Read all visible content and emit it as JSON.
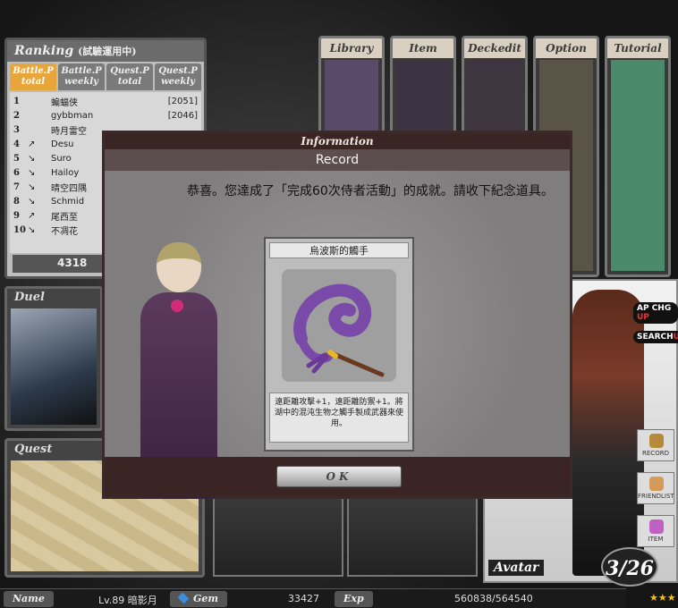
{
  "ranking": {
    "title": "Ranking",
    "subtitle": "(試驗運用中)",
    "tabs": [
      {
        "label": "Battle.P",
        "sub": "total"
      },
      {
        "label": "Battle.P",
        "sub": "weekly"
      },
      {
        "label": "Quest.P",
        "sub": "total"
      },
      {
        "label": "Quest.P",
        "sub": "weekly"
      }
    ],
    "rows": [
      {
        "rank": "1",
        "arrow": "",
        "name": "蝙蝠侠",
        "score": "[2051]"
      },
      {
        "rank": "2",
        "arrow": "",
        "name": "gybbman",
        "score": "[2046]"
      },
      {
        "rank": "3",
        "arrow": "",
        "name": "時月雷空",
        "score": ""
      },
      {
        "rank": "4",
        "arrow": "↗",
        "name": "Desu",
        "score": ""
      },
      {
        "rank": "5",
        "arrow": "↘",
        "name": "Suro",
        "score": ""
      },
      {
        "rank": "6",
        "arrow": "↘",
        "name": "Hailoy",
        "score": ""
      },
      {
        "rank": "7",
        "arrow": "↘",
        "name": "晴空四隅",
        "score": ""
      },
      {
        "rank": "8",
        "arrow": "↘",
        "name": "Schmid",
        "score": ""
      },
      {
        "rank": "9",
        "arrow": "↗",
        "name": "尾西至",
        "score": ""
      },
      {
        "rank": "10",
        "arrow": "↘",
        "name": "不凋花",
        "score": ""
      }
    ],
    "my_score": "4318"
  },
  "menu": {
    "library": "Library",
    "item": "Item",
    "deckedit": "Deckedit",
    "option": "Option",
    "tutorial": "Tutorial"
  },
  "panels": {
    "duel": "Duel",
    "quest": "Quest",
    "avatar": "Avatar"
  },
  "side": {
    "ap_chg": "AP CHG",
    "ap_chg_up": "UP",
    "search": "SEARCH",
    "search_up": "UP",
    "record": "RECORD",
    "friendlist": "FRIENDLIST",
    "item": "ITEM",
    "level": "3/26",
    "stars": "★★★"
  },
  "status": {
    "name_label": "Name",
    "name_value": "Lv.89 暗影月",
    "gem_label": "Gem",
    "gem_value": "33427",
    "exp_label": "Exp",
    "exp_value": "560838/564540"
  },
  "modal": {
    "title": "Information",
    "subtitle": "Record",
    "message": "恭喜。您達成了「完成60次侍者活動」的成就。請收下紀念道具。",
    "card_name": "烏波斯的觸手",
    "card_desc": "遠距離攻擊+1，遠距離防禦+1。將湖中的混沌生物之觸手製成武器來使用。",
    "ok_label": "OK"
  },
  "colors": {
    "modal_frame": "#3a2424",
    "tab_active": "#e8a63a",
    "tentacle": "#7a4aa8",
    "gem": "#3a8ee0"
  }
}
